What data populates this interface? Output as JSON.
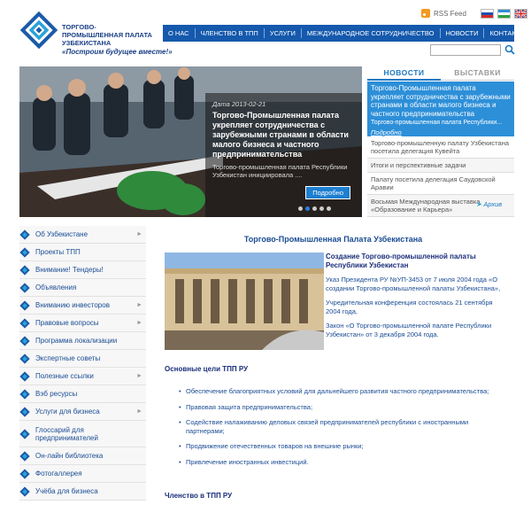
{
  "header": {
    "org_name": "ТОРГОВО-ПРОМЫШЛЕННАЯ ПАЛАТА УЗБЕКИСТАНА",
    "slogan": "«Построим будущее вместе!»",
    "rss_label": "RSS Feed",
    "flags": [
      "russian-flag",
      "uzbek-flag",
      "english-flag"
    ]
  },
  "nav": {
    "items": [
      "О НАС",
      "ЧЛЕНСТВО В ТПП",
      "УСЛУГИ",
      "МЕЖДУНАРОДНОЕ СОТРУДНИЧЕСТВО",
      "НОВОСТИ",
      "КОНТАКТЫ"
    ]
  },
  "search": {
    "placeholder": ""
  },
  "slider": {
    "date": "Дата 2013-02-21",
    "title": "Торгово-Промышленная палата укрепляет сотрудничества с зарубежными странами в области малого бизнеса и частного предпринимательства",
    "text": "Торгово-промышленная палата Республики Узбекистан инициировала ....",
    "more_label": "Подробно",
    "dot_count": 5,
    "active_dot": 1
  },
  "news": {
    "tabs": [
      "НОВОСТИ",
      "ВЫСТАВКИ"
    ],
    "highlight": {
      "title": "Торгово-Промышленная палата укрепляет сотрудничества с зарубежными странами в области малого бизнеса и частного предпринимательства",
      "sub": "Торгово-промышленная палата Республики...",
      "more": "Подробно"
    },
    "items": [
      "Торгово-промышленную палату Узбекистана посетила делегация Кувейта",
      "Итоги и перспективные задачи",
      "Палату посетила делегация Саудовской Аравии",
      "Восьмая Международная выставка «Образование и Карьера»"
    ],
    "archive": "Архив"
  },
  "sidebar": {
    "items": [
      {
        "label": "Об Узбекистане",
        "arrow": true
      },
      {
        "label": "Проекты ТПП",
        "arrow": false
      },
      {
        "label": "Внимание! Тендеры!",
        "arrow": false
      },
      {
        "label": "Объявления",
        "arrow": false
      },
      {
        "label": "Вниманию инвесторов",
        "arrow": true
      },
      {
        "label": "Правовые вопросы",
        "arrow": true
      },
      {
        "label": "Программа локализации",
        "arrow": false
      },
      {
        "label": "Экспертные советы",
        "arrow": false
      },
      {
        "label": "Полезные ссылки",
        "arrow": true
      },
      {
        "label": "Вэб ресурсы",
        "arrow": false
      },
      {
        "label": "Услуги для бизнеса",
        "arrow": true
      },
      {
        "label": "Глоссарий для предпринимателей",
        "arrow": false
      },
      {
        "label": "Он-лайн библиотека",
        "arrow": false
      },
      {
        "label": "Фотогаллерея",
        "arrow": false
      },
      {
        "label": "Учёба для бизнеса",
        "arrow": false
      }
    ]
  },
  "main": {
    "title": "Торгово-Промышленная Палата Узбекистана",
    "intro_heading": "Создание Торгово-промышленной палаты Республики Узбекистан",
    "intro_paragraphs": [
      "Указ Президента РУ №УП-3453 от 7 июля 2004 года «О создании Торгово-промышленной палаты Узбекистана»,",
      "Учредительная конференция состоялась 21 сентября 2004 года,",
      "Закон «О Торгово-промышленной палате Республики Узбекистан» от 3 декабря 2004 года."
    ],
    "goals_heading": "Основные цели ТПП РУ",
    "goals": [
      "Обеспечение благоприятных условий для дальнейшего развития частного предпринимательства;",
      "Правовая защита предпринимательства;",
      "Содействие налаживанию деловых связей предпринимателей республики с иностранными партнерами;",
      "Продвижение отечественных товаров на внешние рынки;",
      "Привлечение иностранных инвестиций."
    ],
    "membership_heading": "Членство в ТПП РУ"
  },
  "colors": {
    "primary": "#1559ad",
    "accent": "#2d8fd8",
    "text_blue": "#1a4c94"
  }
}
